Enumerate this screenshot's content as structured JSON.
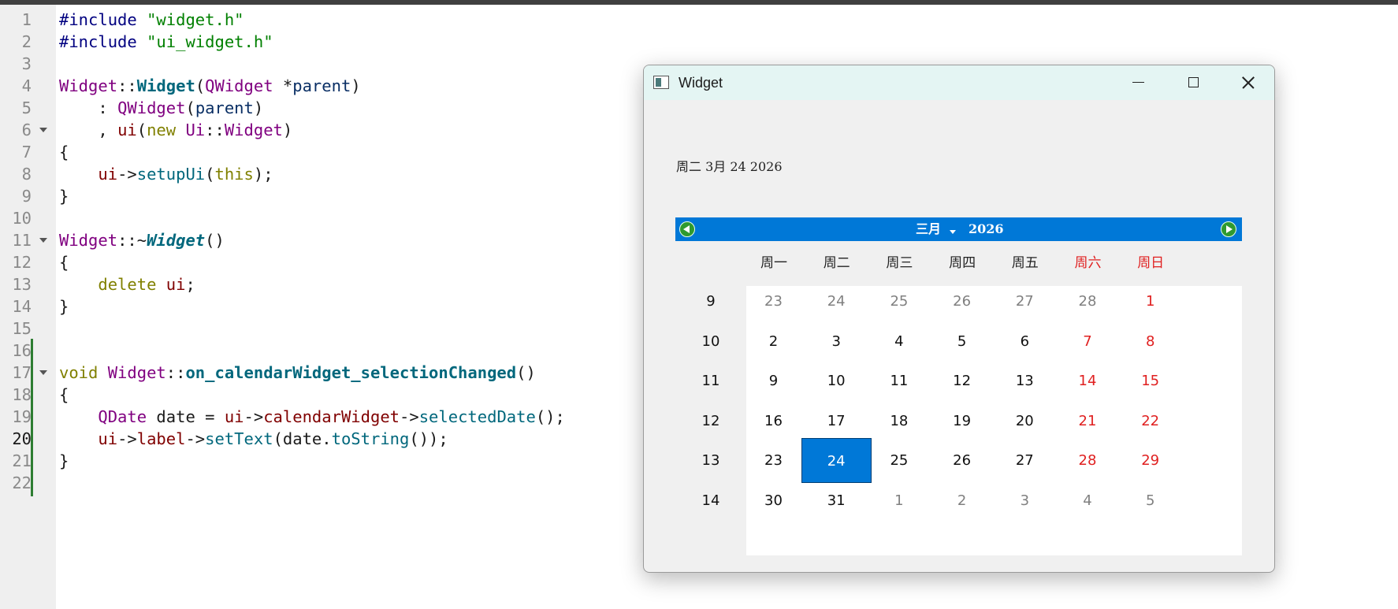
{
  "editor": {
    "lines": [
      {
        "n": "1"
      },
      {
        "n": "2"
      },
      {
        "n": "3"
      },
      {
        "n": "4"
      },
      {
        "n": "5"
      },
      {
        "n": "6"
      },
      {
        "n": "7"
      },
      {
        "n": "8"
      },
      {
        "n": "9"
      },
      {
        "n": "10"
      },
      {
        "n": "11"
      },
      {
        "n": "12"
      },
      {
        "n": "13"
      },
      {
        "n": "14"
      },
      {
        "n": "15"
      },
      {
        "n": "16"
      },
      {
        "n": "17"
      },
      {
        "n": "18"
      },
      {
        "n": "19"
      },
      {
        "n": "20"
      },
      {
        "n": "21"
      },
      {
        "n": "22"
      }
    ],
    "code": {
      "l1_pp": "#include ",
      "l1_str": "\"widget.h\"",
      "l2_pp": "#include ",
      "l2_str": "\"ui_widget.h\"",
      "l4_cls": "Widget",
      "l4_sep": "::",
      "l4_fn": "Widget",
      "l4_paren": "(",
      "l4_ty": "QWidget",
      "l4_ptr": " *",
      "l4_arg": "parent",
      "l4_close": ")",
      "l5_colon": "    : ",
      "l5_ty": "QWidget",
      "l5_open": "(",
      "l5_arg": "parent",
      "l5_close": ")",
      "l6_comma": "    , ",
      "l6_mem": "ui",
      "l6_open": "(",
      "l6_kw": "new ",
      "l6_ty": "Ui",
      "l6_sep": "::",
      "l6_ty2": "Widget",
      "l6_close": ")",
      "l7": "{",
      "l8_ind": "    ",
      "l8_mem": "ui",
      "l8_arrow": "->",
      "l8_fn": "setupUi",
      "l8_open": "(",
      "l8_kw": "this",
      "l8_close": ");",
      "l9": "}",
      "l11_cls": "Widget",
      "l11_sep": "::~",
      "l11_fn": "Widget",
      "l11_paren": "()",
      "l12": "{",
      "l13_ind": "    ",
      "l13_kw": "delete ",
      "l13_mem": "ui",
      "l13_semi": ";",
      "l14": "}",
      "l17_kw": "void ",
      "l17_cls": "Widget",
      "l17_sep": "::",
      "l17_fn": "on_calendarWidget_selectionChanged",
      "l17_paren": "()",
      "l18": "{",
      "l19_ind": "    ",
      "l19_ty": "QDate",
      "l19_var": " date = ",
      "l19_mem": "ui",
      "l19_arrow": "->",
      "l19_mem2": "calendarWidget",
      "l19_arrow2": "->",
      "l19_fn": "selectedDate",
      "l19_end": "();",
      "l20_ind": "    ",
      "l20_mem": "ui",
      "l20_arrow": "->",
      "l20_mem2": "label",
      "l20_arrow2": "->",
      "l20_fn": "setText",
      "l20_open": "(date.",
      "l20_fn2": "toString",
      "l20_end": "());",
      "l21": "}"
    }
  },
  "window": {
    "title": "Widget",
    "label_text": "周二 3月 24 2026"
  },
  "calendar": {
    "month": "三月",
    "year": "2026",
    "weekday_headers": [
      "周一",
      "周二",
      "周三",
      "周四",
      "周五",
      "周六",
      "周日"
    ],
    "weeks": [
      {
        "wk": "9",
        "days": [
          "23",
          "24",
          "25",
          "26",
          "27",
          "28",
          "1"
        ]
      },
      {
        "wk": "10",
        "days": [
          "2",
          "3",
          "4",
          "5",
          "6",
          "7",
          "8"
        ]
      },
      {
        "wk": "11",
        "days": [
          "9",
          "10",
          "11",
          "12",
          "13",
          "14",
          "15"
        ]
      },
      {
        "wk": "12",
        "days": [
          "16",
          "17",
          "18",
          "19",
          "20",
          "21",
          "22"
        ]
      },
      {
        "wk": "13",
        "days": [
          "23",
          "24",
          "25",
          "26",
          "27",
          "28",
          "29"
        ]
      },
      {
        "wk": "14",
        "days": [
          "30",
          "31",
          "1",
          "2",
          "3",
          "4",
          "5"
        ]
      }
    ],
    "selected": "24",
    "colors": {
      "header_bar": "#0078d7",
      "selected": "#0078d7",
      "weekend": "#e02020",
      "other_month": "#808080"
    }
  }
}
